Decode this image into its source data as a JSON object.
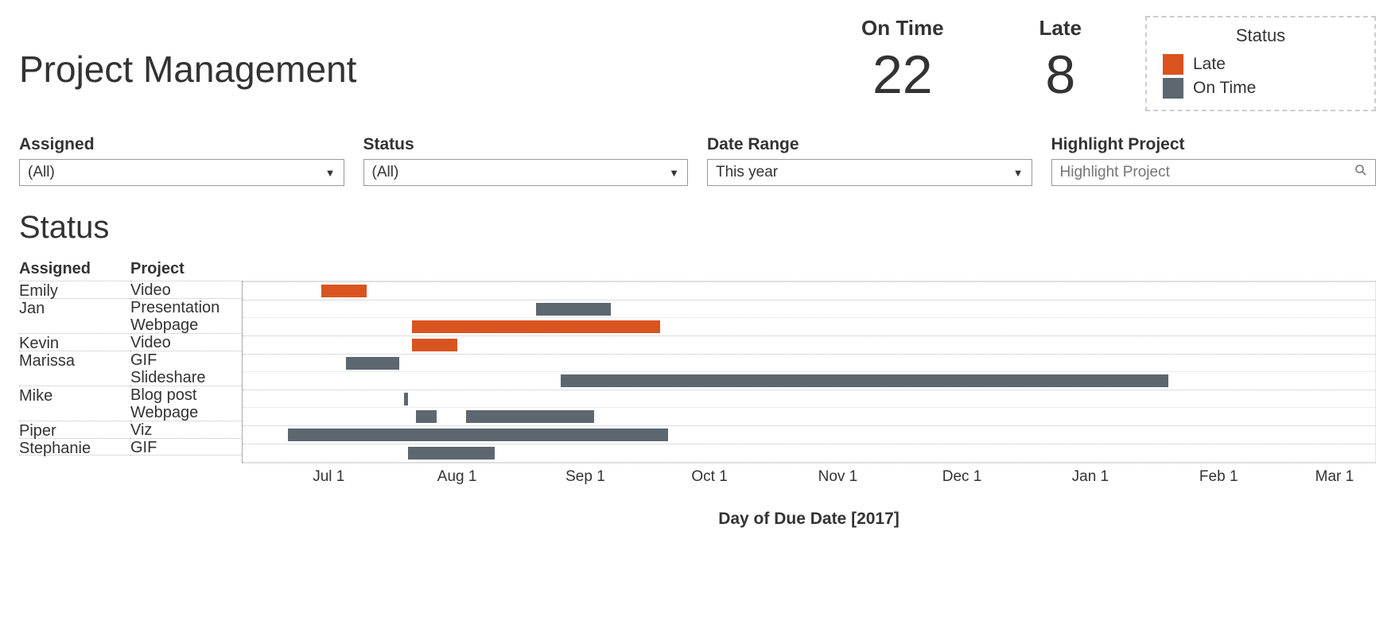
{
  "title": "Project Management",
  "kpis": {
    "ontime": {
      "label": "On Time",
      "value": "22"
    },
    "late": {
      "label": "Late",
      "value": "8"
    }
  },
  "legend": {
    "title": "Status",
    "items": [
      {
        "label": "Late",
        "color": "#d9541e"
      },
      {
        "label": "On Time",
        "color": "#5c6770"
      }
    ]
  },
  "filters": {
    "assigned": {
      "label": "Assigned",
      "value": "(All)"
    },
    "status": {
      "label": "Status",
      "value": "(All)"
    },
    "date": {
      "label": "Date Range",
      "value": "This year"
    },
    "highlight": {
      "label": "Highlight Project",
      "placeholder": "Highlight Project"
    }
  },
  "section_title": "Status",
  "columns": {
    "assigned": "Assigned",
    "project": "Project"
  },
  "axis_label": "Day of Due Date [2017]",
  "chart_data": {
    "type": "bar",
    "orientation": "gantt-horizontal",
    "x_axis": {
      "unit": "date",
      "range_days": [
        161,
        435
      ],
      "ticks": [
        {
          "day": 182,
          "label": "Jul 1"
        },
        {
          "day": 213,
          "label": "Aug 1"
        },
        {
          "day": 244,
          "label": "Sep 1"
        },
        {
          "day": 274,
          "label": "Oct 1"
        },
        {
          "day": 305,
          "label": "Nov 1"
        },
        {
          "day": 335,
          "label": "Dec 1"
        },
        {
          "day": 366,
          "label": "Jan 1"
        },
        {
          "day": 397,
          "label": "Feb 1"
        },
        {
          "day": 425,
          "label": "Mar 1"
        }
      ]
    },
    "rows": [
      {
        "assigned": "Emily",
        "project": "Video",
        "start": 180,
        "end": 191,
        "status": "Late"
      },
      {
        "assigned": "Jan",
        "project": "Presentation",
        "start": 232,
        "end": 250,
        "status": "On Time"
      },
      {
        "assigned": "Jan",
        "project": "Webpage",
        "start": 202,
        "end": 262,
        "status": "Late"
      },
      {
        "assigned": "Kevin",
        "project": "Video",
        "start": 202,
        "end": 213,
        "status": "Late"
      },
      {
        "assigned": "Marissa",
        "project": "GIF",
        "start": 186,
        "end": 199,
        "status": "On Time"
      },
      {
        "assigned": "Marissa",
        "project": "Slideshare",
        "start": 238,
        "end": 385,
        "status": "On Time"
      },
      {
        "assigned": "Mike",
        "project": "Blog post",
        "start": 200,
        "end": 201,
        "status": "On Time"
      },
      {
        "assigned": "Mike",
        "project": "Webpage",
        "start": 203,
        "end": 208,
        "status": "On Time",
        "extra": {
          "start": 215,
          "end": 246
        }
      },
      {
        "assigned": "Piper",
        "project": "Viz",
        "start": 172,
        "end": 264,
        "status": "On Time"
      },
      {
        "assigned": "Stephanie",
        "project": "GIF",
        "start": 201,
        "end": 222,
        "status": "On Time"
      }
    ]
  }
}
